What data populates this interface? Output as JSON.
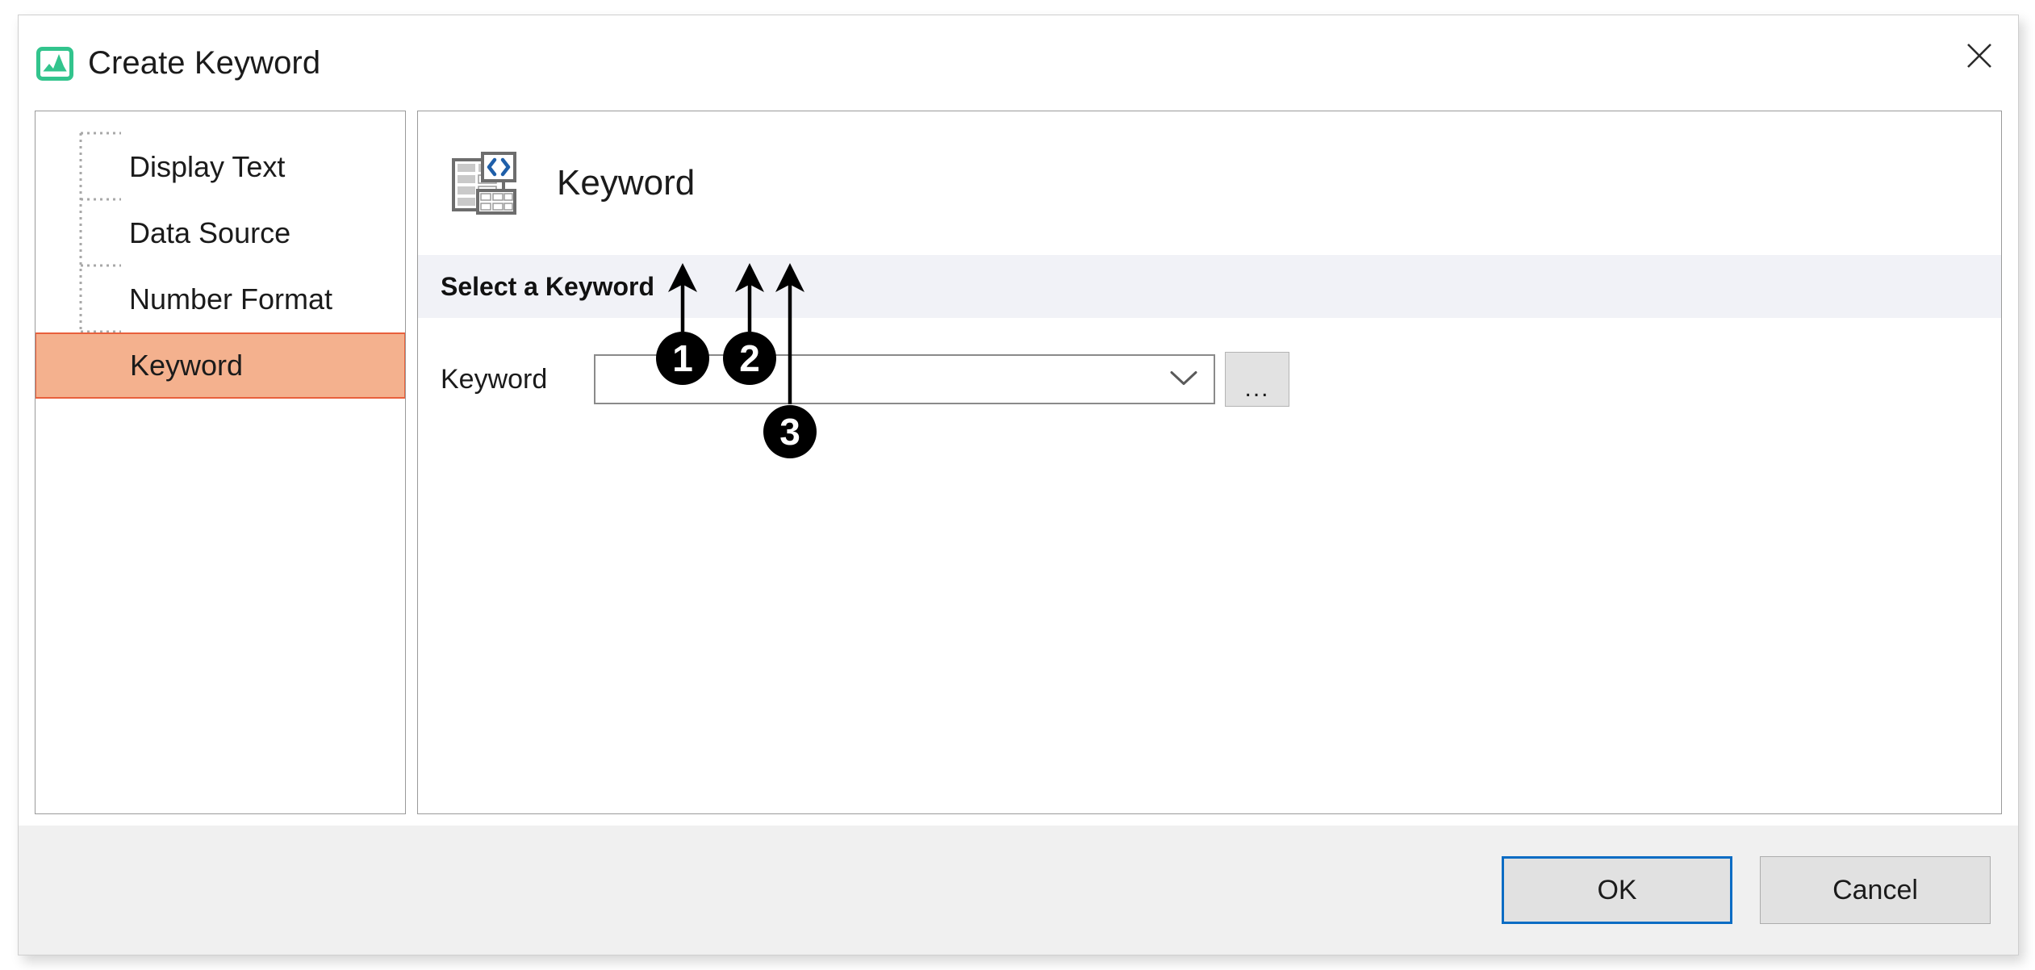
{
  "window": {
    "title": "Create Keyword",
    "icon": "image-chart-icon",
    "close_label": "✕"
  },
  "sidebar": {
    "items": [
      {
        "label": "Display Text",
        "selected": false
      },
      {
        "label": "Data Source",
        "selected": false
      },
      {
        "label": "Number Format",
        "selected": false
      },
      {
        "label": "Keyword",
        "selected": true
      }
    ]
  },
  "content": {
    "icon": "table-code-icon",
    "title": "Keyword",
    "section_header": "Select a Keyword",
    "fields": [
      {
        "label": "Keyword",
        "value": "",
        "placeholder": "",
        "dropdown_icon": "chevron-down-icon",
        "browse_button_label": "..."
      }
    ]
  },
  "annotations": [
    {
      "number": "1"
    },
    {
      "number": "2"
    },
    {
      "number": "3"
    }
  ],
  "footer": {
    "ok_label": "OK",
    "cancel_label": "Cancel"
  },
  "colors": {
    "selection_fill": "#f4b18e",
    "selection_border": "#e8603c",
    "accent_blue": "#0a6cc4",
    "brand_green": "#32c48d",
    "band_gray": "#f1f2f7",
    "footer_gray": "#f0f0f0"
  }
}
